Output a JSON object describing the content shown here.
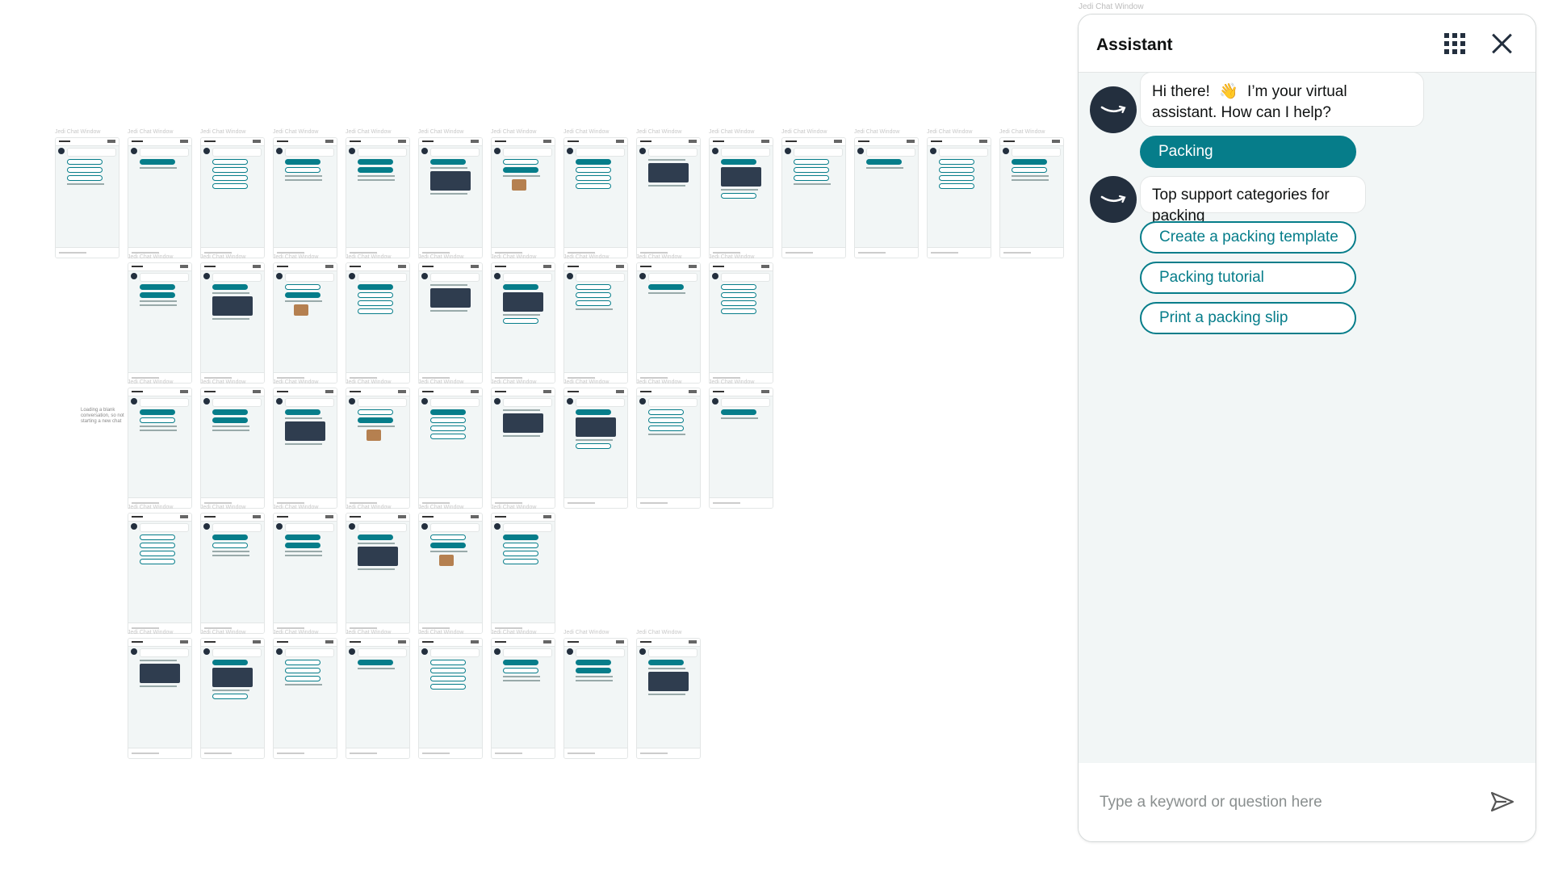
{
  "canvas": {
    "thumbnail_label": "Jedi Chat Window",
    "side_note": "Loading a blank conversation, so not starting a new chat"
  },
  "chat": {
    "window_label": "Jedi Chat Window",
    "title": "Assistant",
    "icons": {
      "menu": "grid-icon",
      "close": "close-icon",
      "send": "send-icon",
      "avatar": "amazon-smile-logo"
    },
    "colors": {
      "accent": "#067d8a",
      "avatar_bg": "#232f3e",
      "chat_bg": "#f2f6f6"
    },
    "greeting": {
      "before_emoji": "Hi there!",
      "emoji": "👋",
      "after_emoji": "I’m your virtual assistant. How can I help?"
    },
    "user_reply": "Packing",
    "bot_reply": "Top support categories for packing",
    "options": [
      "Create a packing template",
      "Packing tutorial",
      "Print a packing slip"
    ],
    "input": {
      "placeholder": "Type a keyword or question here",
      "value": ""
    }
  }
}
